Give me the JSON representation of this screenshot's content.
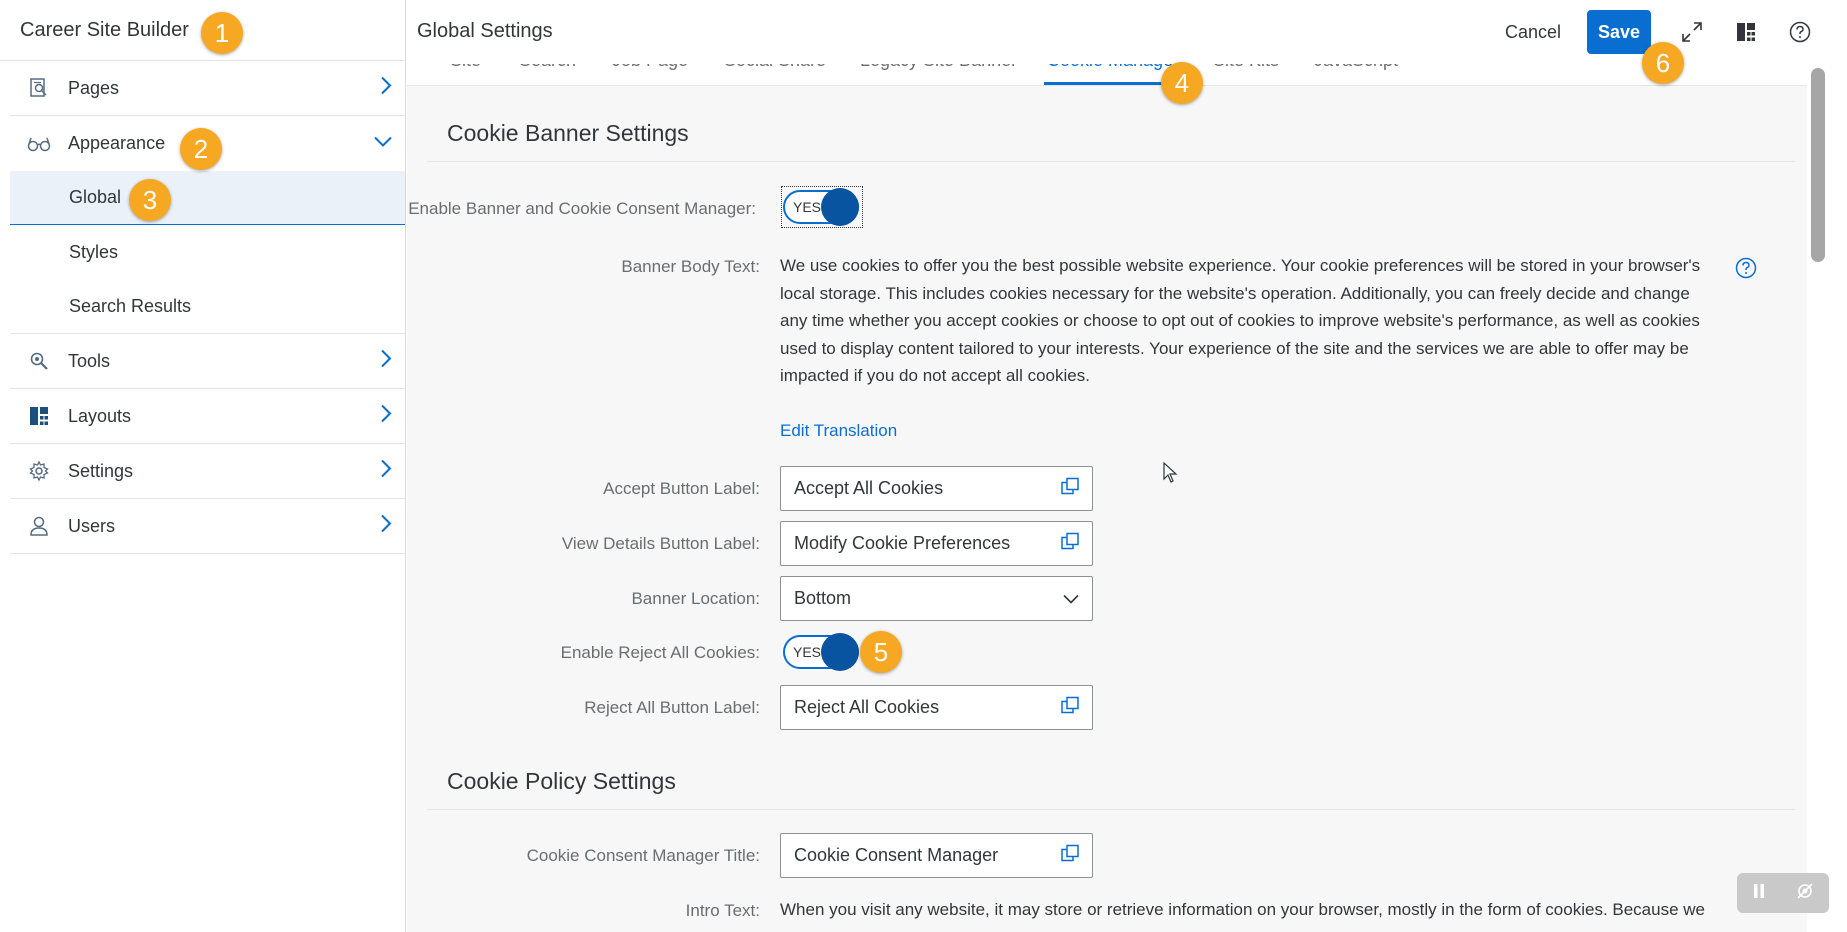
{
  "sidebar": {
    "title": "Career Site Builder",
    "items": [
      {
        "label": "Pages",
        "icon": "page-search-icon"
      },
      {
        "label": "Appearance",
        "icon": "glasses-icon"
      },
      {
        "label": "Tools",
        "icon": "tools-icon"
      },
      {
        "label": "Layouts",
        "icon": "layout-icon"
      },
      {
        "label": "Settings",
        "icon": "gear-icon"
      },
      {
        "label": "Users",
        "icon": "user-icon"
      }
    ],
    "appearance_sub": [
      "Global",
      "Styles",
      "Search Results"
    ]
  },
  "header": {
    "title": "Global Settings",
    "cancel_label": "Cancel",
    "save_label": "Save",
    "icons": [
      "expand-icon",
      "layout-icon",
      "help-icon"
    ]
  },
  "tabs": [
    {
      "label": "Site"
    },
    {
      "label": "Search"
    },
    {
      "label": "Job Page"
    },
    {
      "label": "Social Share"
    },
    {
      "label": "Legacy Site Banner"
    },
    {
      "label": "Cookie Manager",
      "active": true
    },
    {
      "label": "Site Kits"
    },
    {
      "label": "JavaScript"
    }
  ],
  "cookie_banner": {
    "title": "Cookie Banner Settings",
    "enable_label": "Enable Banner and Cookie Consent Manager:",
    "enable_value": "YES",
    "body_label": "Banner Body Text:",
    "body_text": "We use cookies to offer you the best possible website experience. Your cookie preferences will be stored in your browser's local storage. This includes cookies necessary for the website's operation. Additionally, you can freely decide and change any time whether you accept cookies or choose to opt out of cookies to improve website's performance, as well as cookies used to display content tailored to your interests. Your experience of the site and the services we are able to offer may be impacted if you do not accept all cookies.",
    "edit_translation": "Edit Translation",
    "accept_label": "Accept Button Label:",
    "accept_value": "Accept All Cookies",
    "view_details_label": "View Details Button Label:",
    "view_details_value": "Modify Cookie Preferences",
    "location_label": "Banner Location:",
    "location_value": "Bottom",
    "reject_enable_label": "Enable Reject All Cookies:",
    "reject_enable_value": "YES",
    "reject_label": "Reject All Button Label:",
    "reject_value": "Reject All Cookies"
  },
  "cookie_policy": {
    "title": "Cookie Policy Settings",
    "manager_title_label": "Cookie Consent Manager Title:",
    "manager_title_value": "Cookie Consent Manager",
    "intro_label": "Intro Text:",
    "intro_text": "When you visit any website, it may store or retrieve information on your browser, mostly in the form of cookies. Because we"
  },
  "badges": [
    "1",
    "2",
    "3",
    "4",
    "5",
    "6"
  ],
  "colors": {
    "accent": "#0a6ed1",
    "toggle_knob": "#0854a0",
    "badge": "#f6a822",
    "content_bg": "#f7f7f7"
  }
}
